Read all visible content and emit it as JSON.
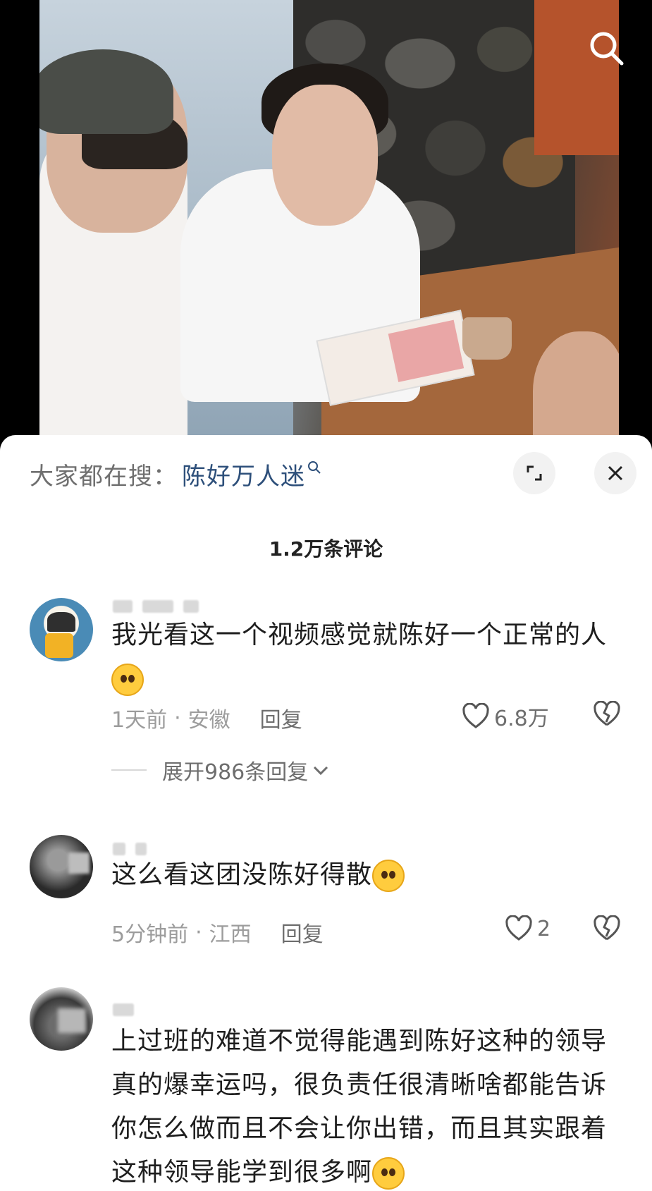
{
  "search_bar": {
    "prefix": "大家都在搜：",
    "term": "陈好万人迷"
  },
  "comments_header": {
    "count_label": "1.2万条评论"
  },
  "comments": [
    {
      "text": "我光看这一个视频感觉就陈好一个正常的人",
      "time": "1天前",
      "location": "安徽",
      "reply_label": "回复",
      "likes": "6.8万",
      "expand_label": "展开986条回复"
    },
    {
      "text": "这么看这团没陈好得散",
      "time": "5分钟前",
      "location": "江西",
      "reply_label": "回复",
      "likes": "2"
    },
    {
      "text": "上过班的难道不觉得能遇到陈好这种的领导真的爆幸运吗，很负责任很清晰啥都能告诉你怎么做而且不会让你出错，而且其实跟着这种领导能学到很多啊"
    }
  ],
  "icons": {
    "video_search": "search-icon",
    "expand": "expand-icon",
    "close": "close-icon",
    "like": "heart-icon",
    "dislike": "broken-heart-icon"
  },
  "colors": {
    "search_term": "#2d4f7a",
    "meta": "#9c9c9c",
    "text": "#1e1e1e"
  }
}
